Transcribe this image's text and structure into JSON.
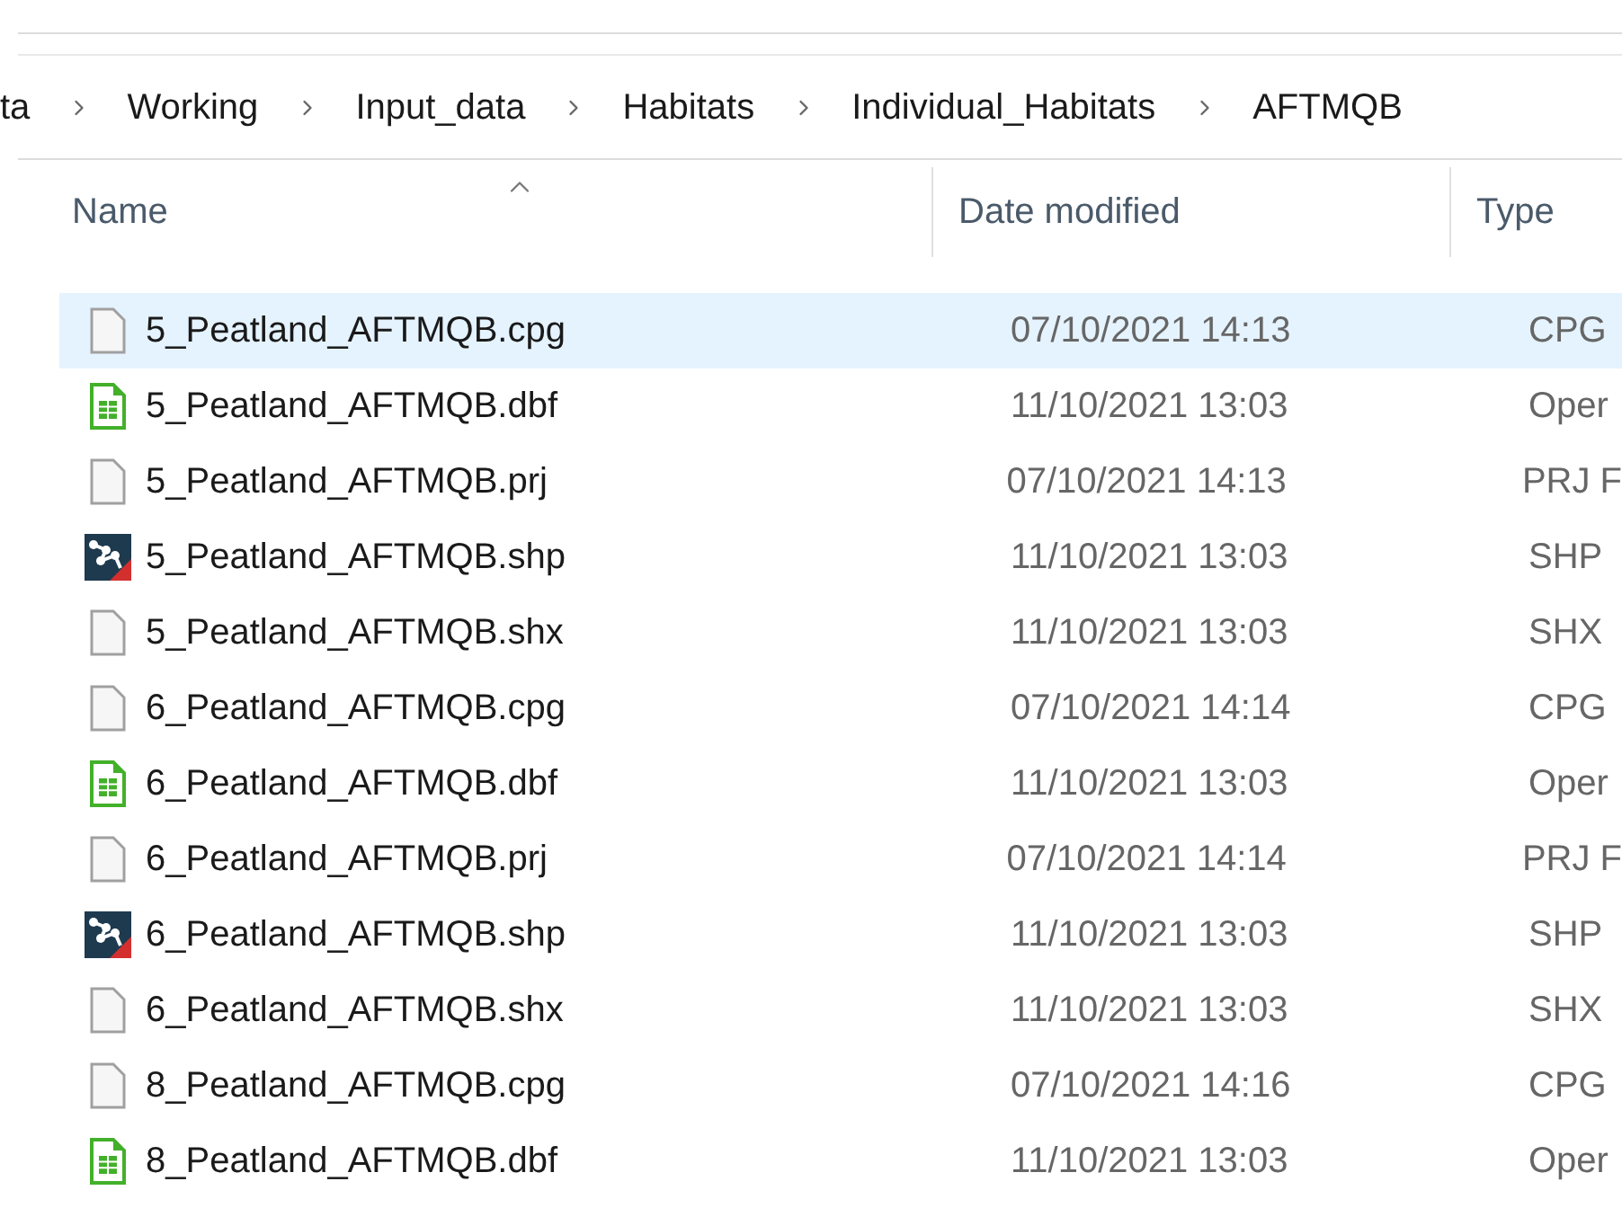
{
  "breadcrumb": [
    "ta",
    "Working",
    "Input_data",
    "Habitats",
    "Individual_Habitats",
    "AFTMQB"
  ],
  "columns": [
    {
      "label": "Name",
      "sorted": true
    },
    {
      "label": "Date modified",
      "sorted": false
    },
    {
      "label": "Type",
      "sorted": false
    }
  ],
  "rows": [
    {
      "kind": "blank",
      "name": "5_Peatland_AFTMQB.cpg",
      "date": "07/10/2021 14:13",
      "type": "CPG",
      "selected": true
    },
    {
      "kind": "sheet",
      "name": "5_Peatland_AFTMQB.dbf",
      "date": "11/10/2021 13:03",
      "type": "Oper",
      "selected": false
    },
    {
      "kind": "blank",
      "name": "5_Peatland_AFTMQB.prj",
      "date": "07/10/2021 14:13",
      "type": "PRJ F",
      "selected": false
    },
    {
      "kind": "shape",
      "name": "5_Peatland_AFTMQB.shp",
      "date": "11/10/2021 13:03",
      "type": "SHP",
      "selected": false
    },
    {
      "kind": "blank",
      "name": "5_Peatland_AFTMQB.shx",
      "date": "11/10/2021 13:03",
      "type": "SHX",
      "selected": false
    },
    {
      "kind": "blank",
      "name": "6_Peatland_AFTMQB.cpg",
      "date": "07/10/2021 14:14",
      "type": "CPG",
      "selected": false
    },
    {
      "kind": "sheet",
      "name": "6_Peatland_AFTMQB.dbf",
      "date": "11/10/2021 13:03",
      "type": "Oper",
      "selected": false
    },
    {
      "kind": "blank",
      "name": "6_Peatland_AFTMQB.prj",
      "date": "07/10/2021 14:14",
      "type": "PRJ F",
      "selected": false
    },
    {
      "kind": "shape",
      "name": "6_Peatland_AFTMQB.shp",
      "date": "11/10/2021 13:03",
      "type": "SHP",
      "selected": false
    },
    {
      "kind": "blank",
      "name": "6_Peatland_AFTMQB.shx",
      "date": "11/10/2021 13:03",
      "type": "SHX",
      "selected": false
    },
    {
      "kind": "blank",
      "name": "8_Peatland_AFTMQB.cpg",
      "date": "07/10/2021 14:16",
      "type": "CPG",
      "selected": false
    },
    {
      "kind": "sheet",
      "name": "8_Peatland_AFTMQB.dbf",
      "date": "11/10/2021 13:03",
      "type": "Oper",
      "selected": false
    }
  ]
}
